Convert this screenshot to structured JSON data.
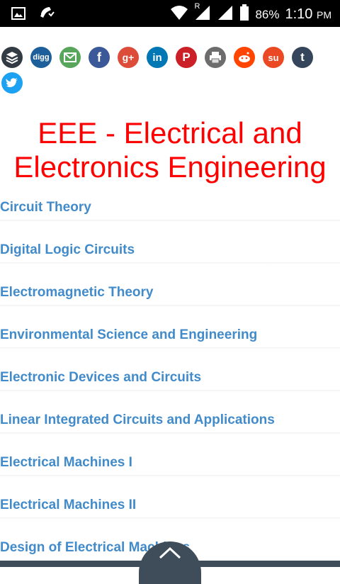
{
  "status_bar": {
    "roaming_indicator": "R",
    "battery_percent": "86%",
    "time": "1:10",
    "ampm": "PM",
    "icons": [
      "image-icon",
      "missed-call-icon",
      "wifi-icon",
      "signal-icon",
      "signal-icon",
      "battery-icon"
    ]
  },
  "share": {
    "icons": [
      {
        "name": "buffer-icon",
        "color": "#323b43"
      },
      {
        "name": "digg-icon",
        "color": "#1d5f9b",
        "label": "digg"
      },
      {
        "name": "email-icon",
        "color": "#58a55c"
      },
      {
        "name": "facebook-icon",
        "color": "#3b5998",
        "label": "f"
      },
      {
        "name": "googleplus-icon",
        "color": "#dd4b39",
        "label": "g+"
      },
      {
        "name": "linkedin-icon",
        "color": "#0077b5",
        "label": "in"
      },
      {
        "name": "pinterest-icon",
        "color": "#cb2027",
        "label": "P"
      },
      {
        "name": "print-icon",
        "color": "#6d6d6d"
      },
      {
        "name": "reddit-icon",
        "color": "#ff4500"
      },
      {
        "name": "stumbleupon-icon",
        "color": "#eb4924",
        "label": "su"
      },
      {
        "name": "tumblr-icon",
        "color": "#35465c",
        "label": "t"
      },
      {
        "name": "twitter-icon",
        "color": "#1da1f2"
      }
    ]
  },
  "page": {
    "title": "EEE - Electrical and Electronics Engineering",
    "accent_color": "#ff0000",
    "link_color": "#428bca"
  },
  "subjects": [
    "Circuit Theory",
    "Digital Logic Circuits",
    "Electromagnetic Theory",
    "Environmental Science and Engineering",
    "Electronic Devices and Circuits",
    "Linear Integrated Circuits and Applications",
    "Electrical Machines I",
    "Electrical Machines II",
    "Design of Electrical Machines"
  ],
  "footer": {
    "scroll_top_icon": "chevron-up-icon",
    "color": "#3f4c59"
  }
}
